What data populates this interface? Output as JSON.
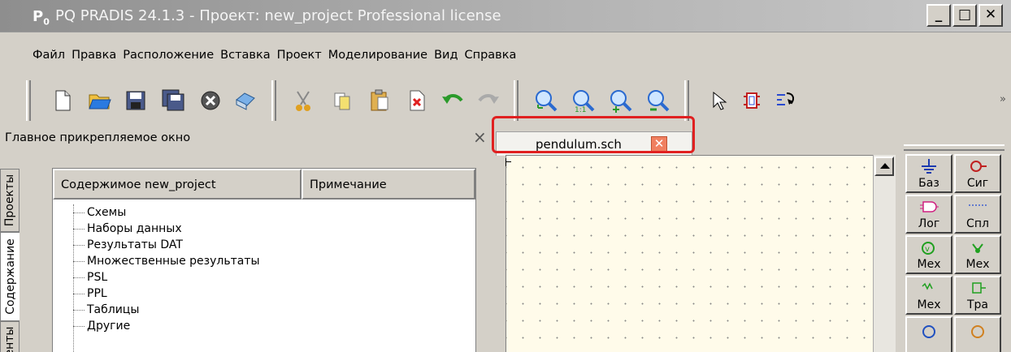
{
  "window": {
    "app_icon": "P",
    "app_icon_sub": "0",
    "title": "PQ PRADIS 24.1.3 - Проект: new_project Professional license",
    "minimize": "_",
    "maximize": "□",
    "close": "✕"
  },
  "menu": [
    "Файл",
    "Правка",
    "Расположение",
    "Вставка",
    "Проект",
    "Моделирование",
    "Вид",
    "Справка"
  ],
  "toolbar": {
    "icons": [
      "new-file-icon",
      "open-folder-icon",
      "save-icon",
      "save-all-icon",
      "stop-icon",
      "print-icon",
      "cut-icon",
      "copy-icon",
      "paste-icon",
      "delete-icon",
      "undo-icon",
      "redo-icon",
      "zoom-fit-icon",
      "zoom-in-icon",
      "zoom-plus-icon",
      "zoom-minus-icon",
      "pointer-icon",
      "component-icon",
      "wire-icon"
    ],
    "overflow": "»"
  },
  "left_panel": {
    "title": "Главное прикрепляемое окно",
    "close": "×",
    "vtabs": [
      "Проекты",
      "Содержание",
      "енты"
    ],
    "columns": [
      "Содержимое new_project",
      "Примечание"
    ],
    "tree": [
      "Схемы",
      "Наборы данных",
      "Результаты DAT",
      "Множественные результаты",
      "PSL",
      "PPL",
      "Таблицы",
      "Другие"
    ]
  },
  "document": {
    "tab_label": "pendulum.sch",
    "tab_close": "✕"
  },
  "palette": {
    "buttons": [
      {
        "label": "Баз",
        "icon": "ground-icon"
      },
      {
        "label": "Сиг",
        "icon": "signal-icon"
      },
      {
        "label": "Лог",
        "icon": "logic-icon"
      },
      {
        "label": "Спл",
        "icon": "spline-icon"
      },
      {
        "label": "Мех",
        "icon": "mech-velocity-icon"
      },
      {
        "label": "Мех",
        "icon": "mech-rotation-icon"
      },
      {
        "label": "Мех",
        "icon": "mech-spring-icon"
      },
      {
        "label": "Тра",
        "icon": "transform-icon"
      }
    ]
  },
  "colors": {
    "highlight": "#e02020",
    "canvas": "#fffbea",
    "tab_close": "#f08060"
  }
}
